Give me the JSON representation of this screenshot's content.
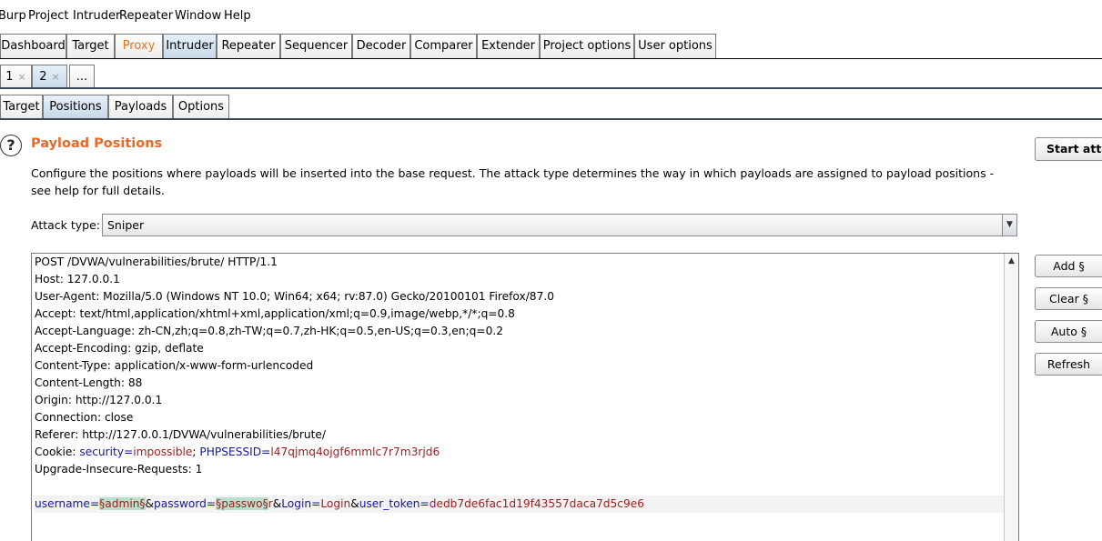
{
  "menu": [
    "Burp",
    "Project",
    "Intruder",
    "Repeater",
    "Window",
    "Help"
  ],
  "main_tabs": [
    "Dashboard",
    "Target",
    "Proxy",
    "Intruder",
    "Repeater",
    "Sequencer",
    "Decoder",
    "Comparer",
    "Extender",
    "Project options",
    "User options"
  ],
  "instance_tabs": [
    "1",
    "2",
    "..."
  ],
  "close_glyph": "×",
  "sub_tabs": [
    "Target",
    "Positions",
    "Payloads",
    "Options"
  ],
  "help_glyph": "?",
  "section": {
    "title": "Payload Positions",
    "description": "Configure the positions where payloads will be inserted into the base request. The attack type determines the way in which payloads are assigned to payload positions - see help for full details."
  },
  "attack_type": {
    "label": "Attack type:",
    "value": "Sniper"
  },
  "buttons": {
    "start": "Start attack",
    "add": "Add §",
    "clear": "Clear §",
    "auto": "Auto §",
    "refresh": "Refresh"
  },
  "request": {
    "lines": [
      "POST /DVWA/vulnerabilities/brute/ HTTP/1.1",
      "Host: 127.0.0.1",
      "User-Agent: Mozilla/5.0 (Windows NT 10.0; Win64; x64; rv:87.0) Gecko/20100101 Firefox/87.0",
      "Accept: text/html,application/xhtml+xml,application/xml;q=0.9,image/webp,*/*;q=0.8",
      "Accept-Language: zh-CN,zh;q=0.8,zh-TW;q=0.7,zh-HK;q=0.5,en-US;q=0.3,en;q=0.2",
      "Accept-Encoding: gzip, deflate",
      "Content-Type: application/x-www-form-urlencoded",
      "Content-Length: 88",
      "Origin: http://127.0.0.1",
      "Connection: close",
      "Referer: http://127.0.0.1/DVWA/vulnerabilities/brute/"
    ],
    "cookie": {
      "label": "Cookie: ",
      "p1_name": "security",
      "eq": "=",
      "p1_value": "impossible",
      "sep": "; ",
      "p2_name": "PHPSESSID",
      "p2_value": "l47qjmq4ojgf6mmlc7r7m3rjd6"
    },
    "upgrade_line": "Upgrade-Insecure-Requests: 1",
    "body": {
      "k1": "username",
      "eq": "=",
      "m1": "§admin§",
      "amp": "&",
      "k2": "password",
      "m2": "§passwo§",
      "tail2": "r",
      "k3": "Login",
      "v3": "Login",
      "k4": "user_token",
      "v4": "dedb7de6fac1d19f43557daca7d5c9e6"
    }
  },
  "colors": {
    "accent_orange": "#e8682a",
    "param_name": "#1616a8",
    "param_value": "#a51d1d",
    "payload_marker_bg": "#b7e1cc"
  }
}
